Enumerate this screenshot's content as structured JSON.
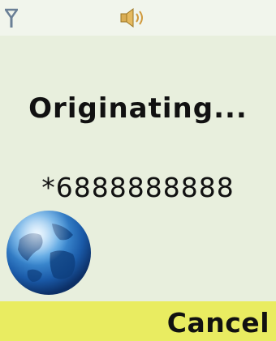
{
  "status_bar": {
    "signal_icon": "antenna-signal-icon",
    "sound_icon": "speaker-volume-icon"
  },
  "call": {
    "status": "Originating...",
    "number": "*6888888888",
    "image_icon": "globe-icon"
  },
  "softkeys": {
    "right_label": "Cancel"
  },
  "colors": {
    "background": "#e8efdd",
    "softkey_bar": "#e9ec61",
    "status_bar": "#f1f5ec"
  }
}
